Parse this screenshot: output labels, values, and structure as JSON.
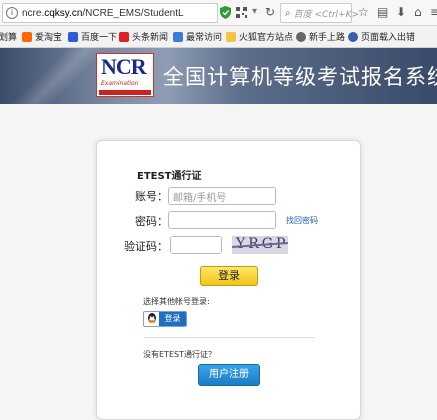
{
  "browser": {
    "url_prefix": "ncre.",
    "url_domain": "cqksy.cn",
    "url_path": "/NCRE_EMS/StudentL",
    "search_placeholder": "百度 <Ctrl+K>"
  },
  "bookmarks": [
    {
      "label": "划算",
      "color": "#d33"
    },
    {
      "label": "爱淘宝",
      "color": "#f60"
    },
    {
      "label": "百度一下",
      "color": "#2b5cd9"
    },
    {
      "label": "头条新闻",
      "color": "#d22"
    },
    {
      "label": "最常访问",
      "color": "#3a7bd5"
    },
    {
      "label": "火狐官方站点",
      "color": "#f5c342"
    },
    {
      "label": "新手上路",
      "color": "#666"
    },
    {
      "label": "页面载入出错",
      "color": "#3a5ea8"
    }
  ],
  "banner": {
    "logo_text": "NCR",
    "logo_sub": "Examination",
    "title": "全国计算机等级考试报名系统"
  },
  "login": {
    "card_title": "ETEST通行证",
    "account_label": "账号：",
    "account_placeholder": "邮箱/手机号",
    "password_label": "密码：",
    "forgot_label": "找回密码",
    "captcha_label": "验证码：",
    "captcha_text": "YRGP",
    "login_button": "登录",
    "other_login_label": "选择其他帐号登录:",
    "qq_login_label": "登录",
    "no_account_label": "没有ETEST通行证？",
    "register_button": "用户注册"
  }
}
